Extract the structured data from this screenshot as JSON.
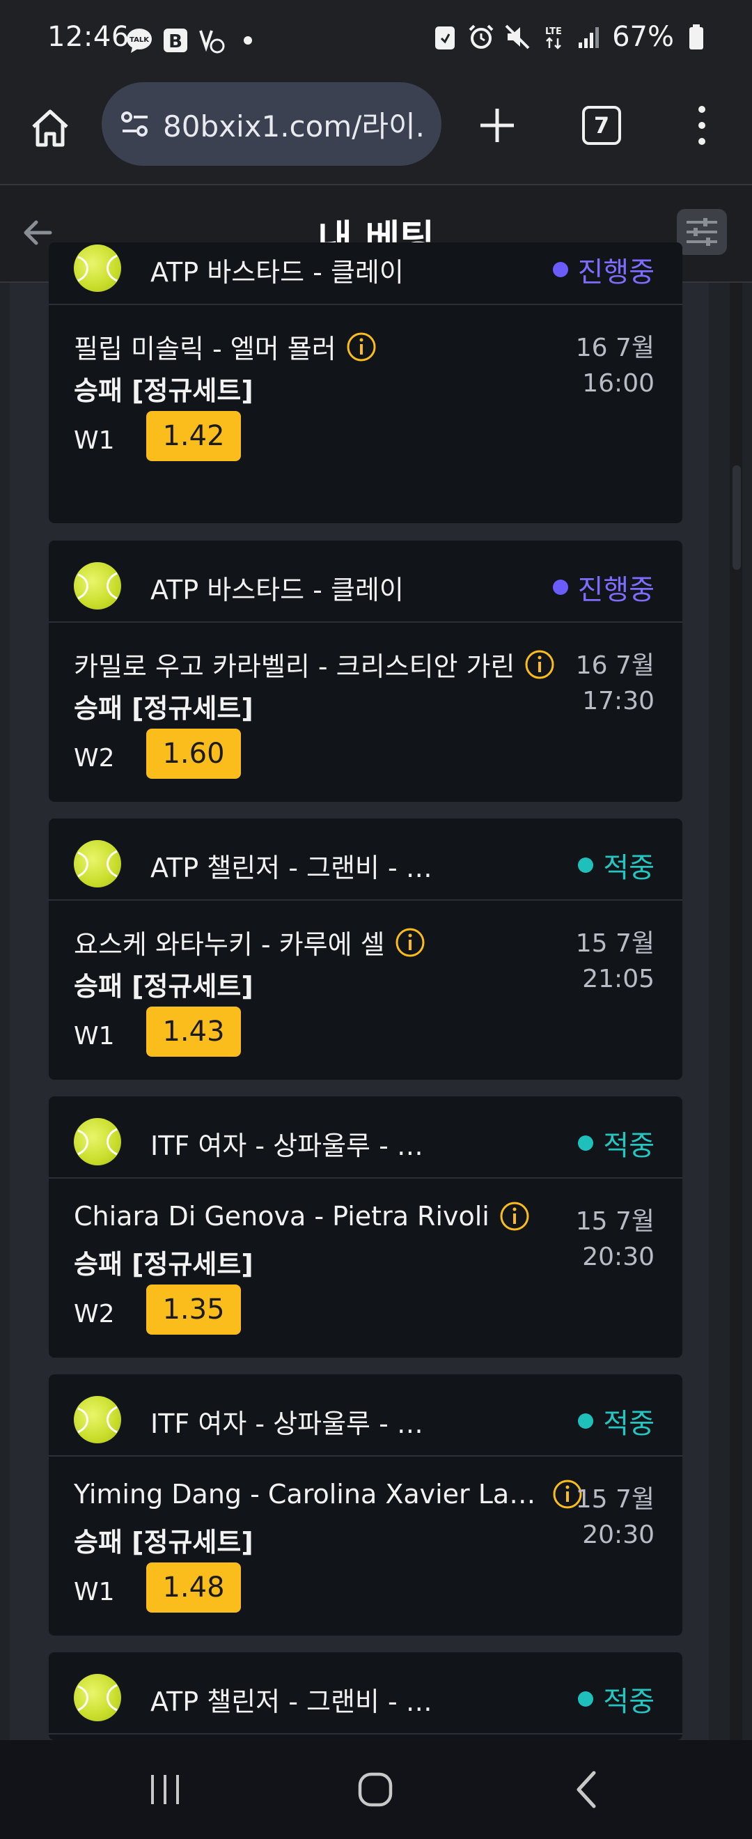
{
  "status_bar": {
    "time": "12:46",
    "battery": "67%",
    "left_icons": [
      "talk-icon",
      "b-icon",
      "vpn-icon",
      "dot-icon"
    ],
    "right_icons": [
      "clipboard-icon",
      "alarm-icon",
      "mute-icon",
      "lte-icon",
      "signal-icon",
      "battery-icon"
    ]
  },
  "browser": {
    "url": "80bxix1.com/라이.",
    "tab_count": "7"
  },
  "header": {
    "title": "내 베팅"
  },
  "bets": [
    {
      "league": "ATP 바스타드 - 클레이",
      "status": "진행중",
      "status_type": "live",
      "match": "필립 미솔릭 - 엘머 묠러",
      "date": "16 7월",
      "time": "16:00",
      "market": "승패 [정규세트]",
      "pick": "W1",
      "odds": "1.42"
    },
    {
      "league": "ATP 바스타드 - 클레이",
      "status": "진행중",
      "status_type": "live",
      "match": "카밀로 우고 카라벨리 - 크리스티안 가린",
      "date": "16 7월",
      "time": "17:30",
      "market": "승패 [정규세트]",
      "pick": "W2",
      "odds": "1.60"
    },
    {
      "league": "ATP 챌린저 - 그랜비 - …",
      "status": "적중",
      "status_type": "win",
      "match": "요스케 와타누키 - 카루에 셀",
      "date": "15 7월",
      "time": "21:05",
      "market": "승패 [정규세트]",
      "pick": "W1",
      "odds": "1.43"
    },
    {
      "league": "ITF 여자 - 상파울루 - …",
      "status": "적중",
      "status_type": "win",
      "match": "Chiara Di Genova - Pietra Rivoli",
      "date": "15 7월",
      "time": "20:30",
      "market": "승패 [정규세트]",
      "pick": "W2",
      "odds": "1.35"
    },
    {
      "league": "ITF 여자 - 상파울루 - …",
      "status": "적중",
      "status_type": "win",
      "match": "Yiming Dang - Carolina Xavier La…",
      "date": "15 7월",
      "time": "20:30",
      "market": "승패 [정규세트]",
      "pick": "W1",
      "odds": "1.48"
    },
    {
      "league": "ATP 챌린저 - 그랜비 - …",
      "status": "적중",
      "status_type": "win",
      "match": "",
      "date": "",
      "time": "",
      "market": "",
      "pick": "",
      "odds": ""
    }
  ],
  "colors": {
    "live": "#6a5cff",
    "win": "#1fc0bc",
    "odds_bg": "#fbbd1c",
    "card_bg": "#111418"
  }
}
